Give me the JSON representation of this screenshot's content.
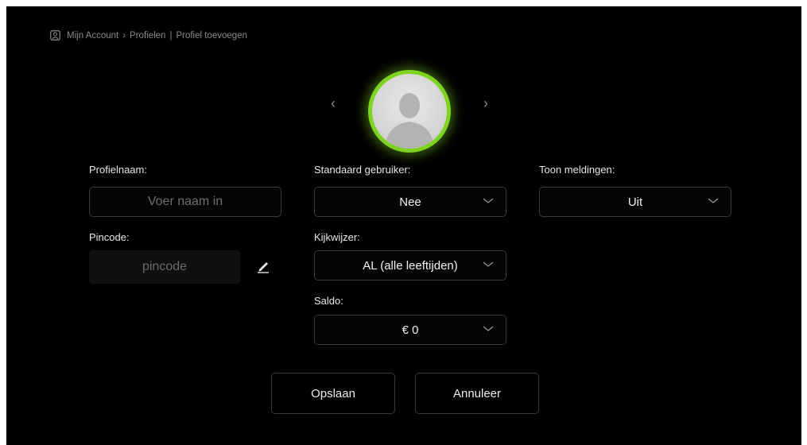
{
  "breadcrumb": {
    "icon": "account-icon",
    "items": [
      "Mijn Account",
      "Profielen",
      "Profiel toevoegen"
    ],
    "separators": [
      "›",
      "|"
    ]
  },
  "avatar": {
    "prev_arrow": "‹",
    "next_arrow": "›",
    "ring_color": "#7ed321",
    "icon": "default-user-icon"
  },
  "form": {
    "profile_name": {
      "label": "Profielnaam:",
      "placeholder": "Voer naam in",
      "value": ""
    },
    "pincode": {
      "label": "Pincode:",
      "placeholder": "pincode",
      "edit_icon": "pencil-icon"
    },
    "default_user": {
      "label": "Standaard gebruiker:",
      "value": "Nee"
    },
    "parental_guide": {
      "label": "Kijkwijzer:",
      "value": "AL (alle leeftijden)"
    },
    "balance": {
      "label": "Saldo:",
      "value": "€ 0"
    },
    "notifications": {
      "label": "Toon meldingen:",
      "value": "Uit"
    }
  },
  "buttons": {
    "save": "Opslaan",
    "cancel": "Annuleer"
  },
  "colors": {
    "background": "#000000",
    "accent": "#7ed321",
    "border": "#3a3a3a"
  }
}
